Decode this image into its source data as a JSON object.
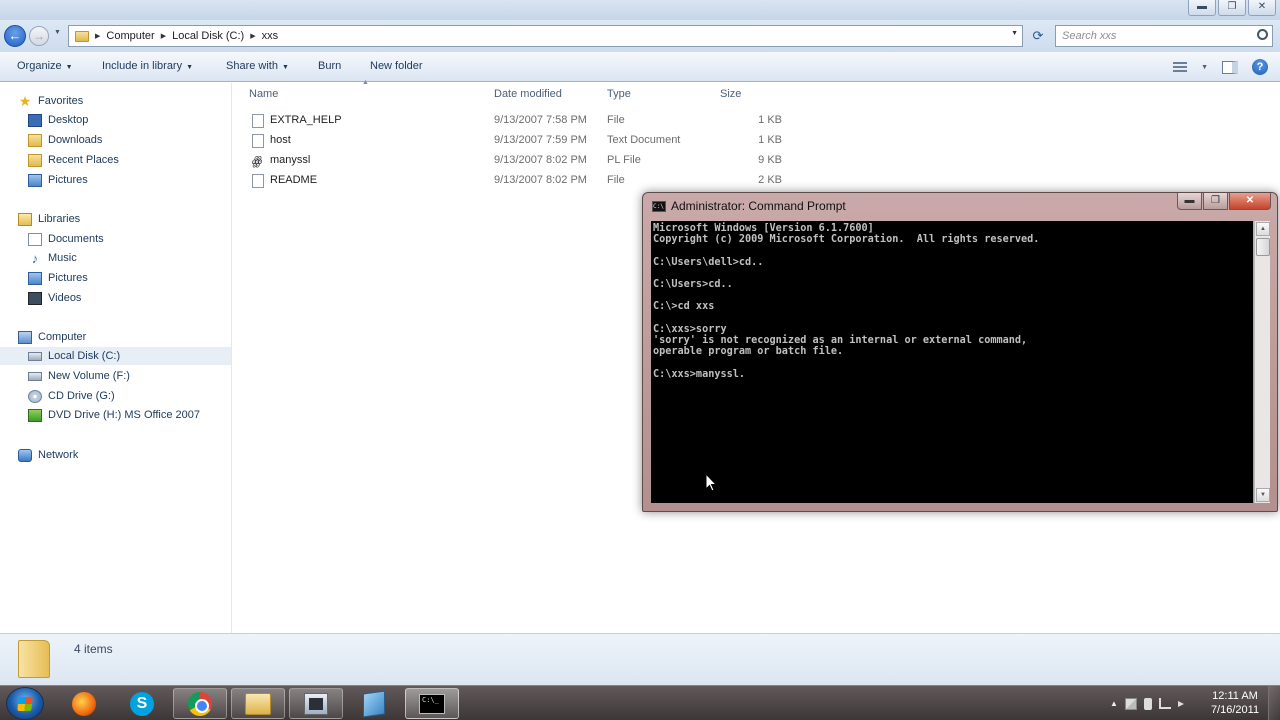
{
  "explorer": {
    "address": {
      "segments": [
        "Computer",
        "Local Disk (C:)",
        "xxs"
      ]
    },
    "search": {
      "placeholder": "Search xxs"
    },
    "commands": {
      "organize": "Organize",
      "include_in_library": "Include in library",
      "share_with": "Share with",
      "burn": "Burn",
      "new_folder": "New folder"
    },
    "nav": {
      "favorites": {
        "label": "Favorites",
        "items": [
          "Desktop",
          "Downloads",
          "Recent Places",
          "Pictures"
        ]
      },
      "libraries": {
        "label": "Libraries",
        "items": [
          "Documents",
          "Music",
          "Pictures",
          "Videos"
        ]
      },
      "computer": {
        "label": "Computer",
        "items": [
          "Local Disk (C:)",
          "New Volume (F:)",
          "CD Drive (G:)",
          "DVD Drive (H:) MS Office 2007"
        ],
        "selected": "Local Disk (C:)"
      },
      "network": {
        "label": "Network"
      }
    },
    "columns": {
      "name": "Name",
      "date": "Date modified",
      "type": "Type",
      "size": "Size"
    },
    "files": [
      {
        "name": "EXTRA_HELP",
        "date": "9/13/2007 7:58 PM",
        "type": "File",
        "size": "1 KB"
      },
      {
        "name": "host",
        "date": "9/13/2007 7:59 PM",
        "type": "Text Document",
        "size": "1 KB"
      },
      {
        "name": "manyssl",
        "date": "9/13/2007 8:02 PM",
        "type": "PL File",
        "size": "9 KB"
      },
      {
        "name": "README",
        "date": "9/13/2007 8:02 PM",
        "type": "File",
        "size": "2 KB"
      }
    ],
    "status": {
      "item_count": "4 items"
    }
  },
  "cmd_window": {
    "title": "Administrator: Command Prompt",
    "lines": [
      "Microsoft Windows [Version 6.1.7600]",
      "Copyright (c) 2009 Microsoft Corporation.  All rights reserved.",
      "",
      "C:\\Users\\dell>cd..",
      "",
      "C:\\Users>cd..",
      "",
      "C:\\>cd xxs",
      "",
      "C:\\xxs>sorry",
      "'sorry' is not recognized as an internal or external command,",
      "operable program or batch file.",
      "",
      "C:\\xxs>manyssl."
    ]
  },
  "taskbar": {
    "apps": [
      "firefox-icon",
      "skype-icon",
      "chrome-icon",
      "explorer-icon",
      "media-icon",
      "app-icon",
      "cmd-icon"
    ],
    "clock": {
      "time": "12:11 AM",
      "date": "7/16/2011"
    }
  }
}
